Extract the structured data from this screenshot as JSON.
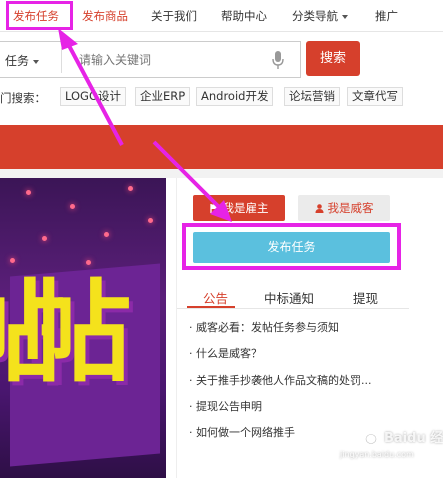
{
  "nav": {
    "items": [
      "发布任务",
      "发布商品",
      "关于我们",
      "帮助中心",
      "分类导航",
      "推广"
    ]
  },
  "search": {
    "type_label": "任务",
    "placeholder": "请输入关键词",
    "button": "搜索"
  },
  "hot": {
    "label": "门搜索：",
    "tags": [
      "LOGO设计",
      "企业ERP",
      "Android开发",
      "论坛营销",
      "文章代写"
    ]
  },
  "promo": {
    "big_char": "帖"
  },
  "panel": {
    "owner_button": "我是雇主",
    "worker_button": "我是威客",
    "publish_button": "发布任务",
    "tabs": [
      "公告",
      "中标通知",
      "提现"
    ],
    "notices": [
      "· 威客必看：发帖任务参与须知",
      "· 什么是威客？",
      "· 关于推手抄袭他人作品文稿的处罚...",
      "· 提现公告申明",
      "· 如何做一个网络推手"
    ]
  },
  "watermark": {
    "text": "Baidu 经验",
    "sub": "jingyan.baidu.com"
  },
  "colors": {
    "brand_red": "#d6402c",
    "publish_blue": "#5bc0de",
    "annotation_magenta": "#e623e6"
  }
}
